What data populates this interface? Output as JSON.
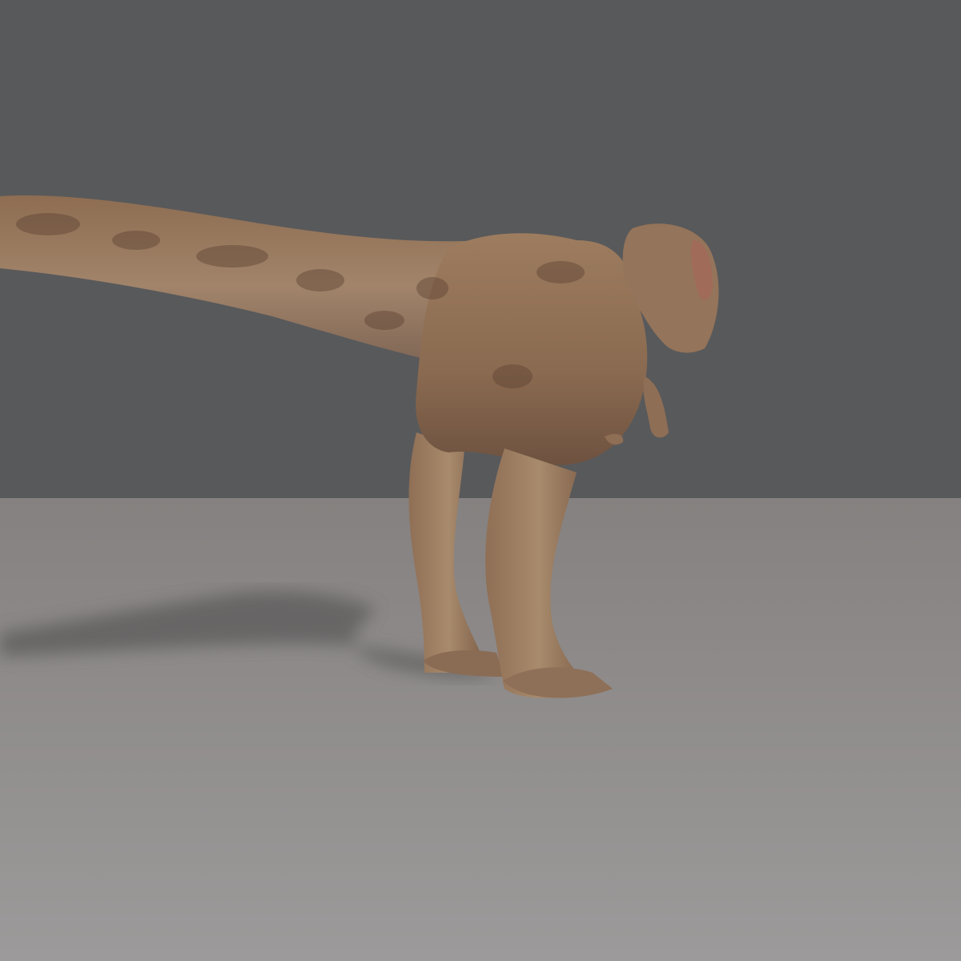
{
  "scene": {
    "subject": "tyrannosaurus",
    "colors": {
      "backdrop": "#58595b",
      "floor_far": "#858180",
      "floor_near": "#9a9898",
      "skin_light": "#a58466",
      "skin_mid": "#8a6a50",
      "skin_dark": "#5e4332",
      "shadow": "#5f5d5d"
    }
  }
}
